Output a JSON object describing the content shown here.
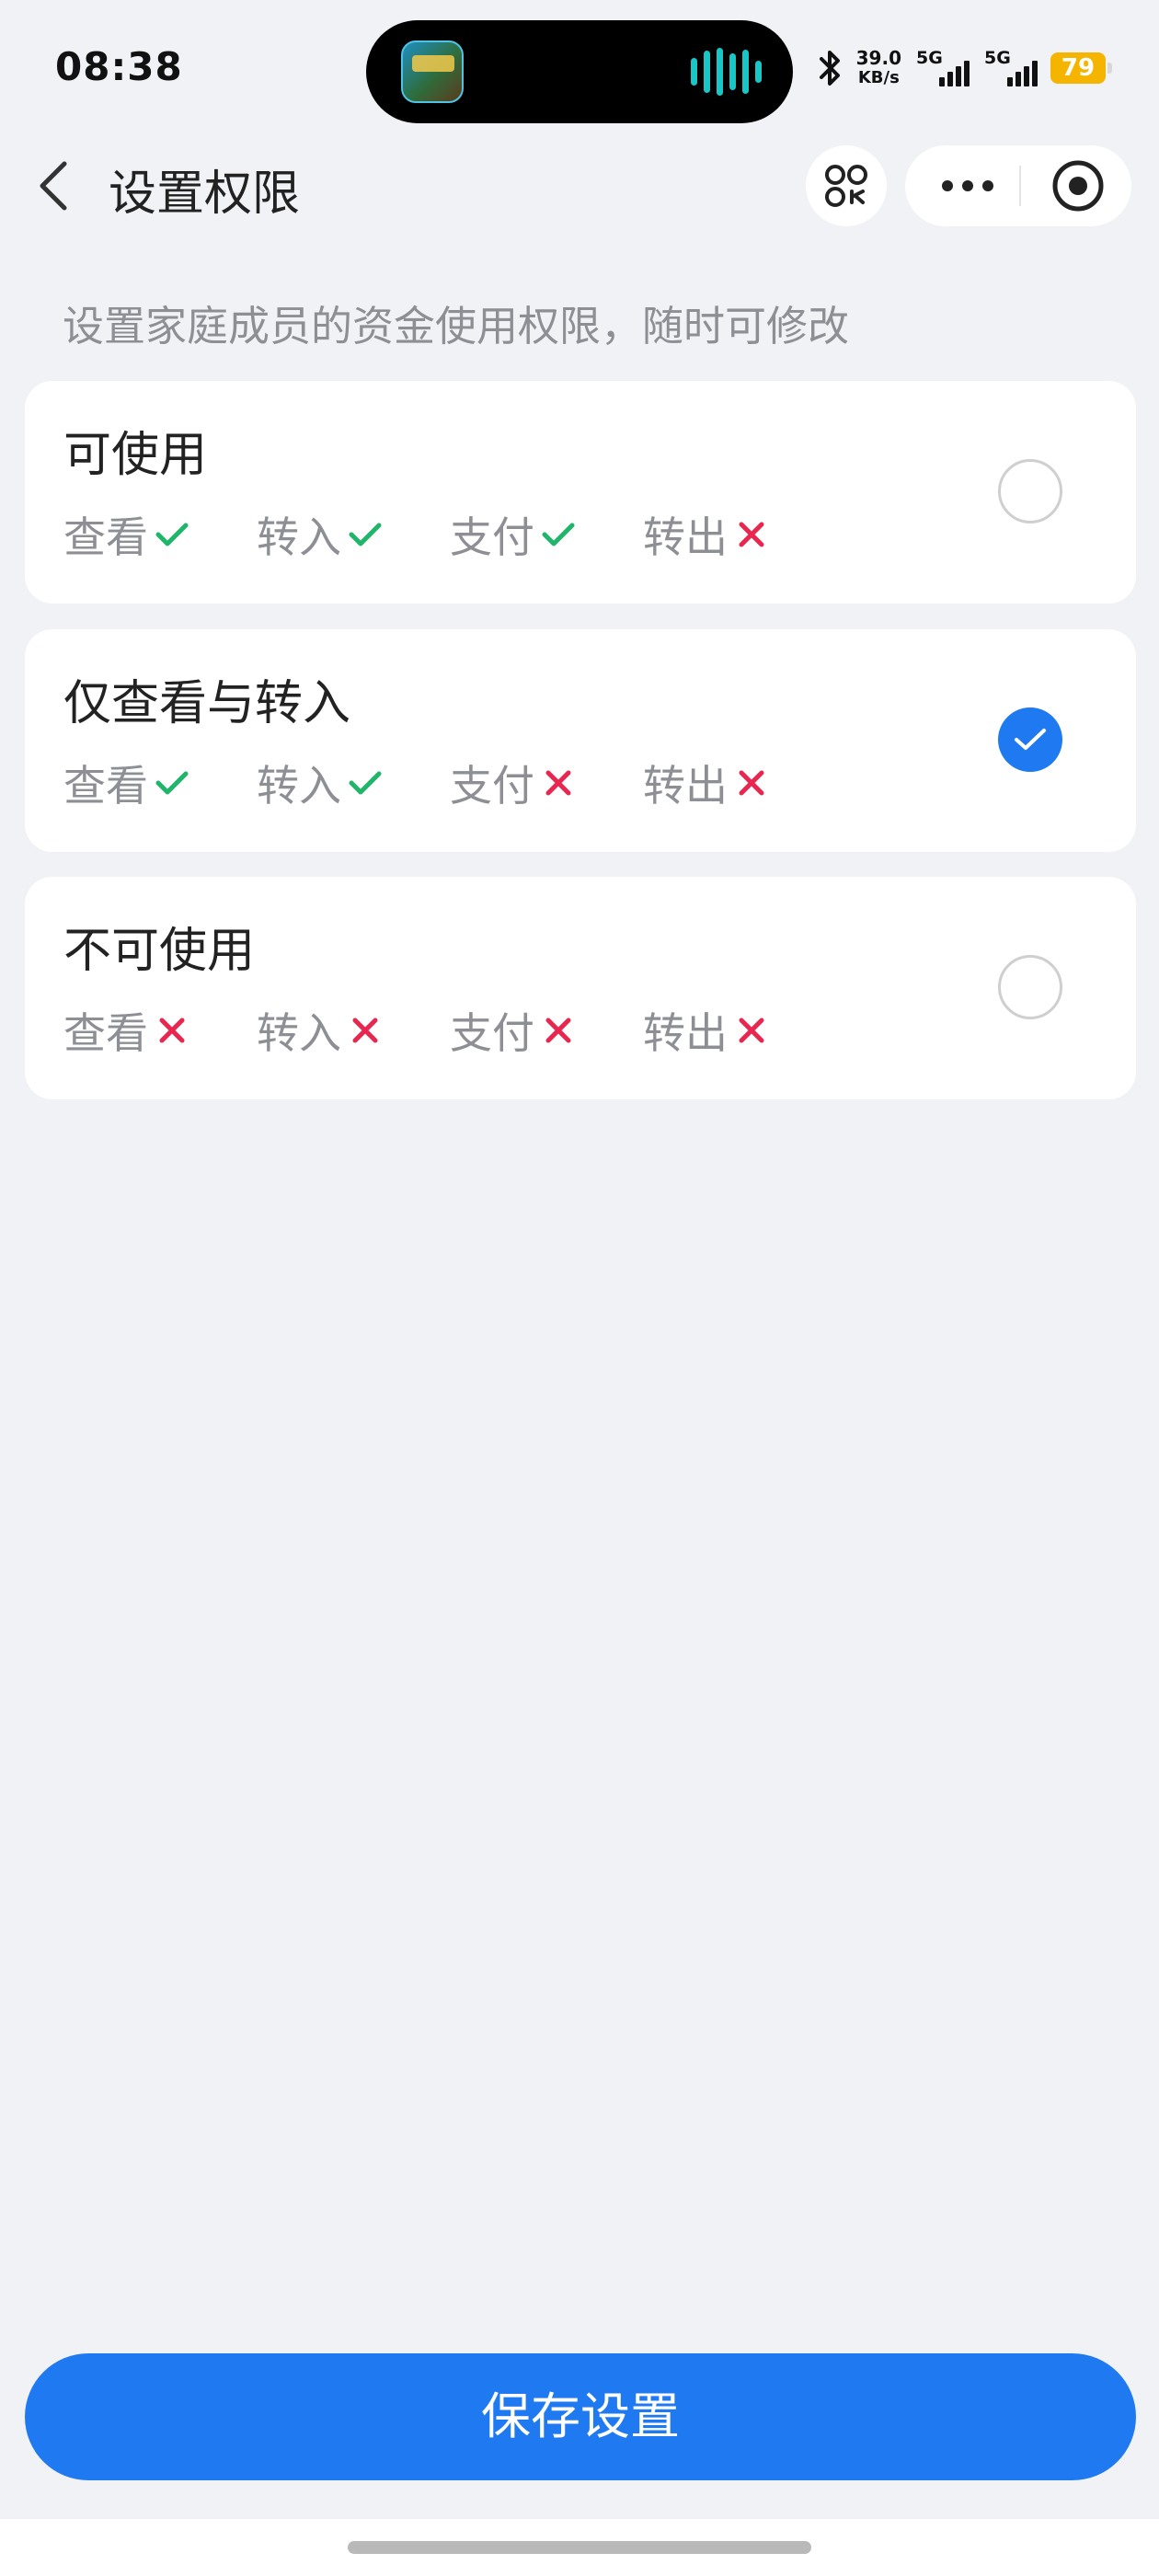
{
  "status_bar": {
    "time": "08:38",
    "net_speed_value": "39.0",
    "net_speed_unit": "KB/s",
    "sim1_label": "5G",
    "sim2_label": "5G",
    "battery": "79",
    "battery_color": "#f5b400",
    "icons": [
      "bluetooth-icon",
      "signal-icon",
      "battery-icon"
    ]
  },
  "header": {
    "title": "设置权限",
    "icons": [
      "back-icon",
      "mini-program-icon",
      "more-icon",
      "close-target-icon"
    ]
  },
  "description": "设置家庭成员的资金使用权限，随时可修改",
  "options": [
    {
      "title": "可使用",
      "selected": false,
      "perms": [
        {
          "label": "查看",
          "allowed": true
        },
        {
          "label": "转入",
          "allowed": true
        },
        {
          "label": "支付",
          "allowed": true
        },
        {
          "label": "转出",
          "allowed": false
        }
      ]
    },
    {
      "title": "仅查看与转入",
      "selected": true,
      "perms": [
        {
          "label": "查看",
          "allowed": true
        },
        {
          "label": "转入",
          "allowed": true
        },
        {
          "label": "支付",
          "allowed": false
        },
        {
          "label": "转出",
          "allowed": false
        }
      ]
    },
    {
      "title": "不可使用",
      "selected": false,
      "perms": [
        {
          "label": "查看",
          "allowed": false
        },
        {
          "label": "转入",
          "allowed": false
        },
        {
          "label": "支付",
          "allowed": false
        },
        {
          "label": "转出",
          "allowed": false
        }
      ]
    }
  ],
  "save_button": "保存设置",
  "colors": {
    "accent": "#1f7af2",
    "allowed": "#1fb56b",
    "denied": "#e8264f",
    "background": "#f0f2f5"
  }
}
